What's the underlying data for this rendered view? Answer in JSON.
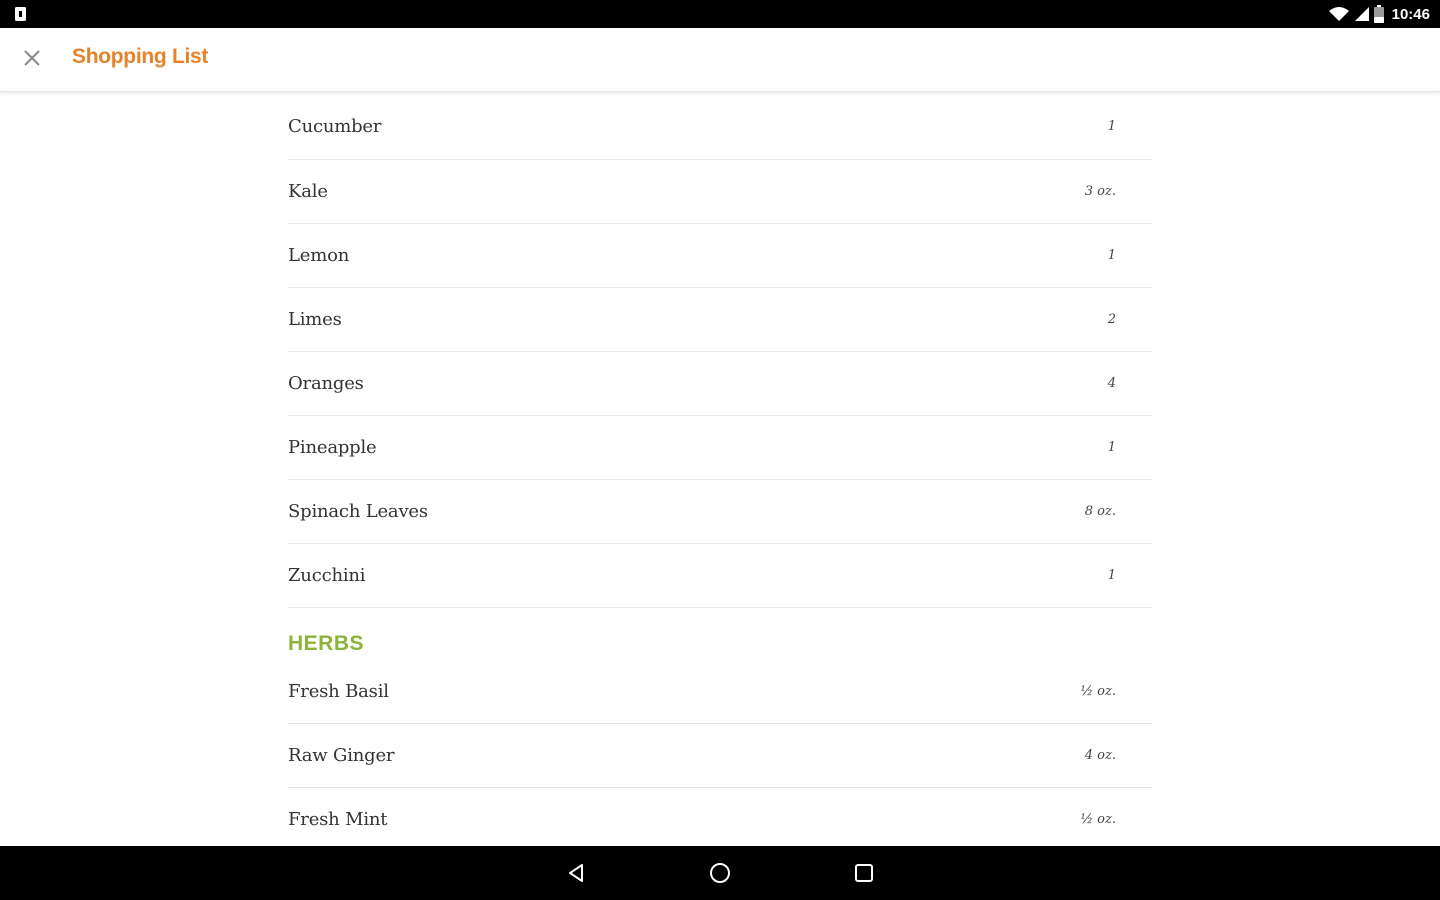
{
  "status_bar": {
    "time": "10:46",
    "icons": [
      "notification-icon",
      "wifi-icon",
      "signal-icon",
      "battery-icon"
    ]
  },
  "app_bar": {
    "title": "Shopping List",
    "close_icon": "close-icon"
  },
  "colors": {
    "title": "#e8822a",
    "section": "#8cb43a",
    "text": "#333333",
    "divider": "#e6e6e6"
  },
  "list": {
    "items_top": [
      {
        "name": "Cucumber",
        "qty": "1"
      },
      {
        "name": "Kale",
        "qty": "3 oz."
      },
      {
        "name": "Lemon",
        "qty": "1"
      },
      {
        "name": "Limes",
        "qty": "2"
      },
      {
        "name": "Oranges",
        "qty": "4"
      },
      {
        "name": "Pineapple",
        "qty": "1"
      },
      {
        "name": "Spinach Leaves",
        "qty": "8 oz."
      },
      {
        "name": "Zucchini",
        "qty": "1"
      }
    ],
    "herbs_header": "HERBS",
    "herbs": [
      {
        "name": "Fresh Basil",
        "qty": "½ oz."
      },
      {
        "name": "Raw Ginger",
        "qty": "4 oz."
      },
      {
        "name": "Fresh Mint",
        "qty": "½ oz."
      }
    ]
  },
  "nav_bar": {
    "buttons": [
      "back-icon",
      "home-icon",
      "recents-icon"
    ]
  }
}
